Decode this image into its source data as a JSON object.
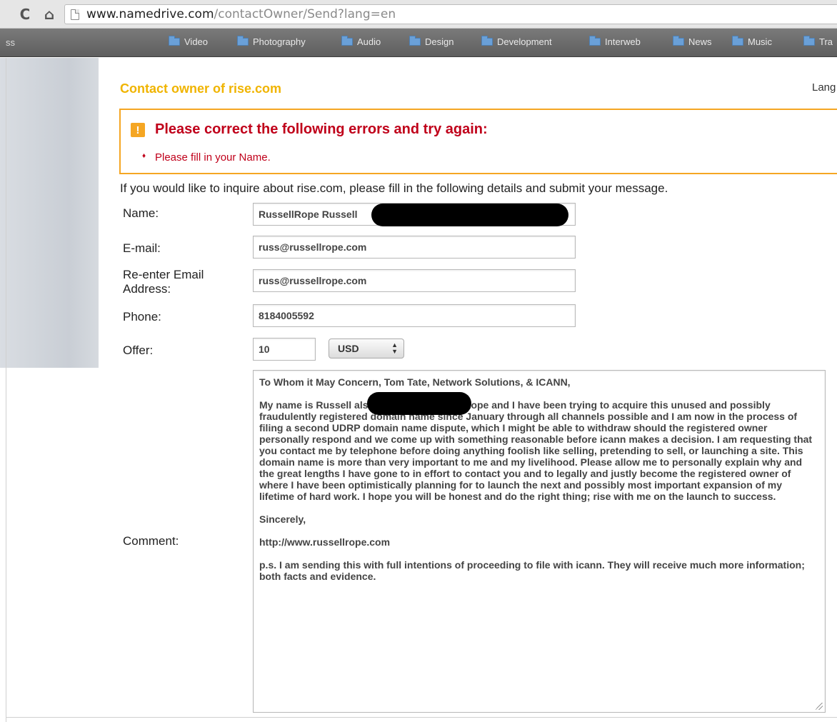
{
  "browser": {
    "url_host": "www.namedrive.com",
    "url_path": "/contactOwner/Send?lang=en",
    "bookmarks_edge": "ss",
    "bookmarks": [
      "Video",
      "Photography",
      "Audio",
      "Design",
      "Development",
      "Interweb",
      "News",
      "Music",
      "Tra"
    ]
  },
  "page": {
    "title": "Contact owner of rise.com",
    "lang_label": "Lang",
    "error": {
      "heading": "Please correct the following errors and try again:",
      "items": [
        "Please fill in your Name."
      ]
    },
    "intro": "If you would like to inquire about rise.com, please fill in the following details and submit your message.",
    "form": {
      "name_label": "Name:",
      "name_value": "RussellRope Russell",
      "email_label": "E-mail:",
      "email_value": "russ@russellrope.com",
      "reemail_label_1": "Re-enter Email",
      "reemail_label_2": "Address:",
      "reemail_value": "russ@russellrope.com",
      "phone_label": "Phone:",
      "phone_value": "8184005592",
      "offer_label": "Offer:",
      "offer_value": "10",
      "currency": "USD",
      "comment_label": "Comment:",
      "comment_paragraphs": [
        "To Whom it May Concern, Tom Tate, Network Solutions, & ICANN,",
        "My name is Russell                               also known as Russell Rope and I have been trying to acquire this unused and possibly fraudulently registered domain name since January through all channels possible and I am now in the process of filing a second UDRP domain name dispute, which I might be able to withdraw should the registered owner personally respond and we come up with something reasonable before icann makes a decision.  I am requesting that you contact me by telephone before doing anything foolish like selling, pretending to sell, or launching a site.  This domain name is more than very important to me and my livelihood.  Please allow me to personally explain why and the great lengths I have gone to in effort to contact you and to legally and justly become the registered owner of where I have been optimistically planning for to launch the next and possibly most important expansion of my lifetime of hard work.  I hope you will be honest and do the right thing; rise with me on the launch to success.",
        "Sincerely,",
        "http://www.russellrope.com",
        "p.s.  I am sending this with full intentions of proceeding to file with icann.  They will receive much more information; both facts and evidence."
      ]
    }
  },
  "colors": {
    "title": "#f0b400",
    "error_border": "#f5a623",
    "error_text": "#c0001a"
  }
}
